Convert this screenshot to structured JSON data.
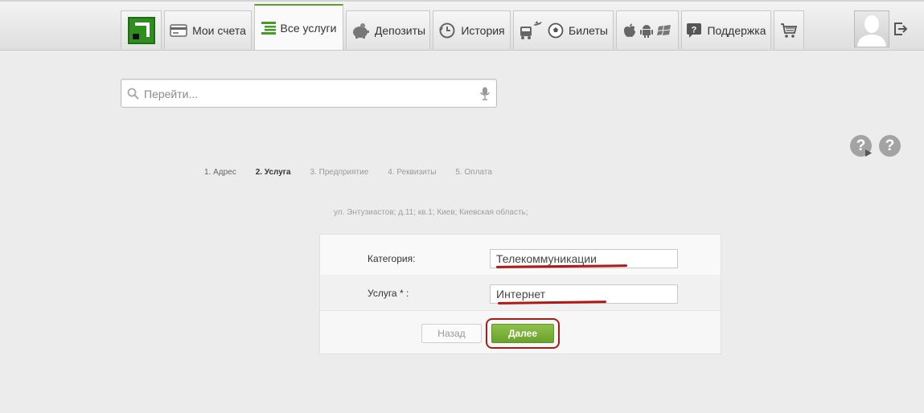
{
  "nav": {
    "tabs": [
      {
        "label": "Мои счета"
      },
      {
        "label": "Все услуги"
      },
      {
        "label": "Депозиты"
      },
      {
        "label": "История"
      },
      {
        "label": "Билеты"
      },
      {
        "label": ""
      },
      {
        "label": "Поддержка"
      },
      {
        "label": ""
      }
    ],
    "active_tab": "Все услуги",
    "icons": [
      "bank-logo-icon",
      "card-icon",
      "list-icon",
      "piggy-bank-icon",
      "history-clock-icon",
      "transport-icon",
      "ball-icon",
      "apple-icon",
      "android-icon",
      "windows-icon",
      "question-icon",
      "cart-icon",
      "avatar-icon",
      "logout-icon"
    ]
  },
  "search": {
    "placeholder": "Перейти..."
  },
  "help": {
    "symbol": "?"
  },
  "steps": [
    {
      "label": "1.  Адрес"
    },
    {
      "label": "2.  Услуга"
    },
    {
      "label": "3.  Предприятие"
    },
    {
      "label": "4.  Реквизиты"
    },
    {
      "label": "5.  Оплата"
    }
  ],
  "address": "ул. Энтузиастов; д.11; кв.1; Киев; Киевская область;",
  "form": {
    "category_label": "Категория:",
    "category_value": "Телекоммуникации",
    "service_label": "Услуга * :",
    "service_value": "Интернет",
    "back_label": "Назад",
    "next_label": "Далее"
  },
  "colors": {
    "accent": "#5f9e2f",
    "next_button": "#7bb33a",
    "highlight": "#a51c1c",
    "background": "#ececec"
  }
}
